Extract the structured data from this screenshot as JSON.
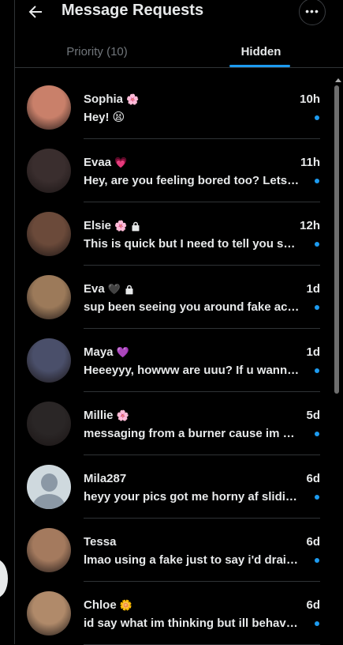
{
  "header": {
    "title": "Message Requests",
    "back_icon": "arrow-left-icon",
    "more_icon": "more-horizontal-icon",
    "more_glyph": "•••"
  },
  "tabs": [
    {
      "label": "Priority (10)",
      "active": false
    },
    {
      "label": "Hidden",
      "active": true
    }
  ],
  "accent_color": "#1d9bf0",
  "conversations": [
    {
      "name": "Sophia",
      "emoji": "🌸",
      "locked": false,
      "time": "10h",
      "preview": "Hey!   😫",
      "unread": true,
      "avatar": "photo",
      "avatar_color": "#c9806a"
    },
    {
      "name": "Evaa",
      "emoji": "💗",
      "locked": false,
      "time": "11h",
      "preview": "Hey, are you feeling bored too? Lets talk",
      "unread": true,
      "avatar": "photo",
      "avatar_color": "#3a2e2e"
    },
    {
      "name": "Elsie",
      "emoji": "🌸",
      "locked": true,
      "time": "12h",
      "preview": "This is quick but I need to tell you something",
      "unread": true,
      "avatar": "photo",
      "avatar_color": "#6b4a3a"
    },
    {
      "name": "Eva",
      "emoji": "🖤",
      "locked": true,
      "time": "1d",
      "preview": "sup been seeing you around fake acc here",
      "unread": true,
      "avatar": "photo",
      "avatar_color": "#9c7a5a"
    },
    {
      "name": "Maya",
      "emoji": "💜",
      "locked": false,
      "time": "1d",
      "preview": "Heeeyyy, howww are uuu? If u wanna chat",
      "unread": true,
      "avatar": "photo",
      "avatar_color": "#4a4f6a"
    },
    {
      "name": "Millie",
      "emoji": "🌸",
      "locked": false,
      "time": "5d",
      "preview": "messaging from a burner cause im shy",
      "unread": true,
      "avatar": "photo",
      "avatar_color": "#2a2626"
    },
    {
      "name": "Mila287",
      "emoji": "",
      "locked": false,
      "time": "6d",
      "preview": "heyy your pics got me horny af sliding in",
      "unread": true,
      "avatar": "default",
      "avatar_color": "#cfd9de"
    },
    {
      "name": "Tessa",
      "emoji": "",
      "locked": false,
      "time": "6d",
      "preview": "lmao using a fake just to say i'd drain you",
      "unread": true,
      "avatar": "photo",
      "avatar_color": "#a47a5e"
    },
    {
      "name": "Chloe",
      "emoji": "🌼",
      "locked": false,
      "time": "6d",
      "preview": "id say what im thinking but ill behave for now",
      "unread": true,
      "avatar": "photo",
      "avatar_color": "#b08a6a"
    }
  ]
}
